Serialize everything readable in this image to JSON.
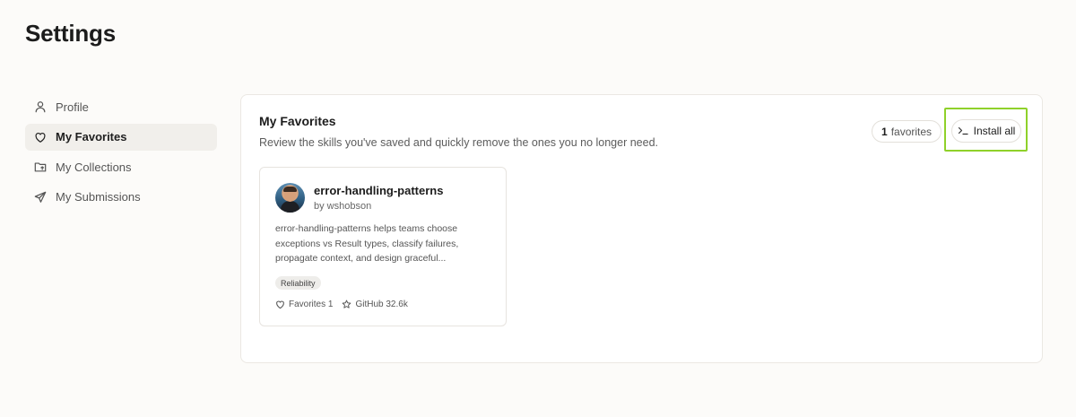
{
  "page": {
    "title": "Settings"
  },
  "sidebar": {
    "items": [
      {
        "label": "Profile",
        "icon": "user-icon",
        "active": false
      },
      {
        "label": "My Favorites",
        "icon": "heart-icon",
        "active": true
      },
      {
        "label": "My Collections",
        "icon": "folder-icon",
        "active": false
      },
      {
        "label": "My Submissions",
        "icon": "send-icon",
        "active": false
      }
    ]
  },
  "favorites": {
    "title": "My Favorites",
    "description": "Review the skills you've saved and quickly remove the ones you no longer need.",
    "count_number": "1",
    "count_label": "favorites",
    "install_label": "Install all",
    "highlight_color": "#8fd12a"
  },
  "skills": [
    {
      "name": "error-handling-patterns",
      "author": "by wshobson",
      "description": "error-handling-patterns helps teams choose exceptions vs Result types, classify failures, propagate context, and design graceful...",
      "tag": "Reliability",
      "favorites": "Favorites 1",
      "github": "GitHub 32.6k"
    }
  ]
}
